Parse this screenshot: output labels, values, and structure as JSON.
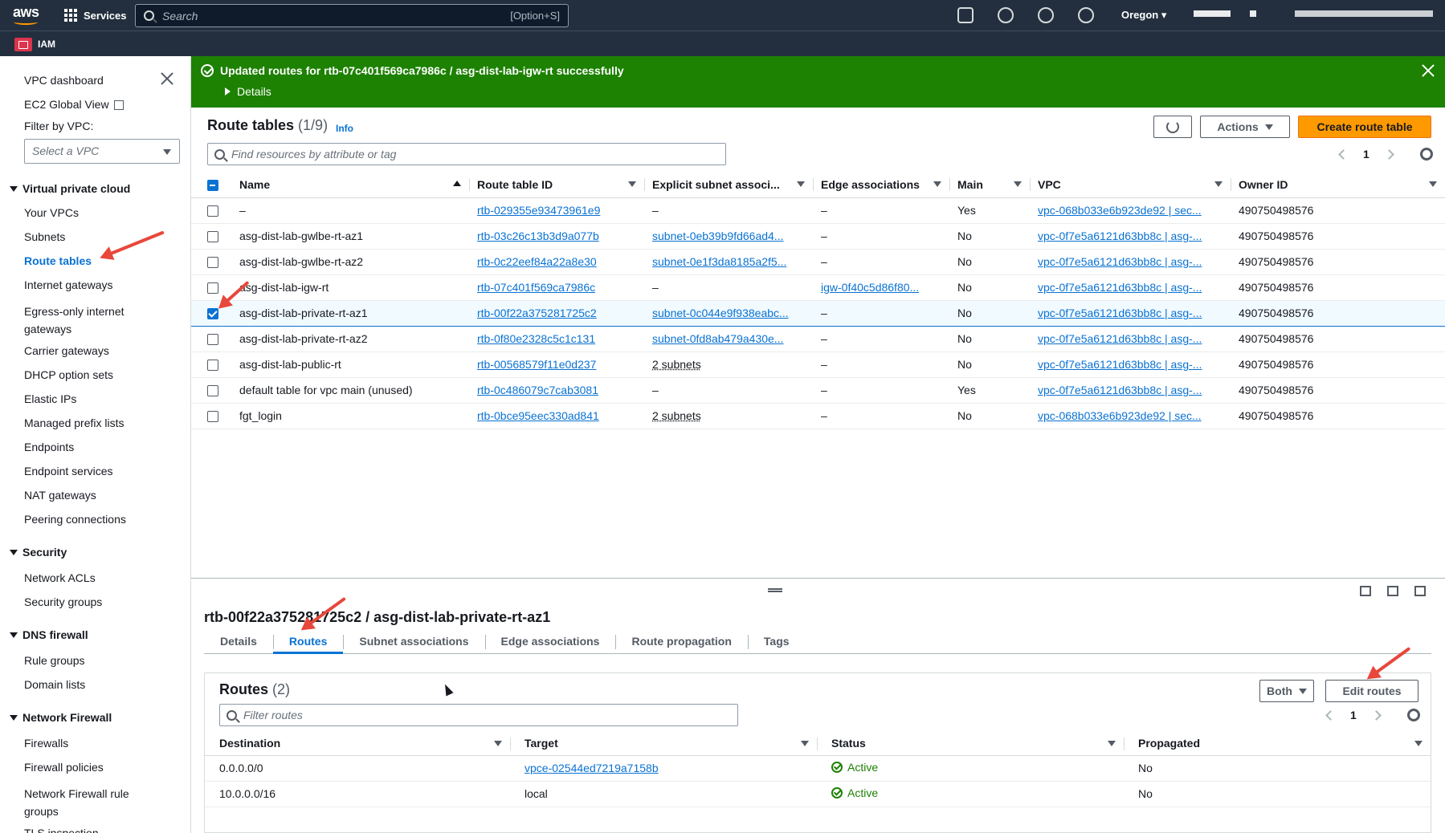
{
  "topnav": {
    "logo": "aws",
    "services_label": "Services",
    "search_placeholder": "Search",
    "search_shortcut": "[Option+S]",
    "region": "Oregon",
    "icons": [
      "cloudshell-icon",
      "bell-icon",
      "help-icon",
      "gear-icon"
    ]
  },
  "subnav": {
    "service_label": "IAM"
  },
  "sidebar": {
    "vpc_dashboard": "VPC dashboard",
    "ec2_global_view": "EC2 Global View",
    "filter_label": "Filter by VPC:",
    "filter_placeholder": "Select a VPC",
    "sections": [
      {
        "title": "Virtual private cloud",
        "items": [
          "Your VPCs",
          "Subnets",
          "Route tables",
          "Internet gateways",
          "Egress-only internet gateways",
          "Carrier gateways",
          "DHCP option sets",
          "Elastic IPs",
          "Managed prefix lists",
          "Endpoints",
          "Endpoint services",
          "NAT gateways",
          "Peering connections"
        ]
      },
      {
        "title": "Security",
        "items": [
          "Network ACLs",
          "Security groups"
        ]
      },
      {
        "title": "DNS firewall",
        "items": [
          "Rule groups",
          "Domain lists"
        ]
      },
      {
        "title": "Network Firewall",
        "items": [
          "Firewalls",
          "Firewall policies",
          "Network Firewall rule groups",
          "TLS inspection"
        ]
      }
    ],
    "active_item": "Route tables"
  },
  "flash": {
    "message": "Updated routes for rtb-07c401f569ca7986c / asg-dist-lab-igw-rt successfully",
    "details_label": "Details"
  },
  "route_tables": {
    "title": "Route tables",
    "count": "(1/9)",
    "info": "Info",
    "actions_label": "Actions",
    "create_label": "Create route table",
    "search_placeholder": "Find resources by attribute or tag",
    "page": "1",
    "columns": [
      "Name",
      "Route table ID",
      "Explicit subnet associ...",
      "Edge associations",
      "Main",
      "VPC",
      "Owner ID"
    ],
    "rows": [
      {
        "name": "–",
        "id": "rtb-029355e93473961e9",
        "subnet": "–",
        "edge": "–",
        "main": "Yes",
        "vpc": "vpc-068b033e6b923de92 | sec...",
        "owner": "490750498576",
        "selected": false
      },
      {
        "name": "asg-dist-lab-gwlbe-rt-az1",
        "id": "rtb-03c26c13b3d9a077b",
        "subnet": "subnet-0eb39b9fd66ad4...",
        "edge": "–",
        "main": "No",
        "vpc": "vpc-0f7e5a6121d63bb8c | asg-...",
        "owner": "490750498576",
        "selected": false
      },
      {
        "name": "asg-dist-lab-gwlbe-rt-az2",
        "id": "rtb-0c22eef84a22a8e30",
        "subnet": "subnet-0e1f3da8185a2f5...",
        "edge": "–",
        "main": "No",
        "vpc": "vpc-0f7e5a6121d63bb8c | asg-...",
        "owner": "490750498576",
        "selected": false
      },
      {
        "name": "asg-dist-lab-igw-rt",
        "id": "rtb-07c401f569ca7986c",
        "subnet": "–",
        "edge": "igw-0f40c5d86f80...",
        "main": "No",
        "vpc": "vpc-0f7e5a6121d63bb8c | asg-...",
        "owner": "490750498576",
        "selected": false
      },
      {
        "name": "asg-dist-lab-private-rt-az1",
        "id": "rtb-00f22a375281725c2",
        "subnet": "subnet-0c044e9f938eabc...",
        "edge": "–",
        "main": "No",
        "vpc": "vpc-0f7e5a6121d63bb8c | asg-...",
        "owner": "490750498576",
        "selected": true
      },
      {
        "name": "asg-dist-lab-private-rt-az2",
        "id": "rtb-0f80e2328c5c1c131",
        "subnet": "subnet-0fd8ab479a430e...",
        "edge": "–",
        "main": "No",
        "vpc": "vpc-0f7e5a6121d63bb8c | asg-...",
        "owner": "490750498576",
        "selected": false
      },
      {
        "name": "asg-dist-lab-public-rt",
        "id": "rtb-00568579f11e0d237",
        "subnet": "2 subnets",
        "edge": "–",
        "main": "No",
        "vpc": "vpc-0f7e5a6121d63bb8c | asg-...",
        "owner": "490750498576",
        "selected": false
      },
      {
        "name": "default table for vpc main (unused)",
        "id": "rtb-0c486079c7cab3081",
        "subnet": "–",
        "edge": "–",
        "main": "Yes",
        "vpc": "vpc-0f7e5a6121d63bb8c | asg-...",
        "owner": "490750498576",
        "selected": false
      },
      {
        "name": "fgt_login",
        "id": "rtb-0bce95eec330ad841",
        "subnet": "2 subnets",
        "edge": "–",
        "main": "No",
        "vpc": "vpc-068b033e6b923de92 | sec...",
        "owner": "490750498576",
        "selected": false
      }
    ]
  },
  "detail": {
    "title": "rtb-00f22a375281725c2 / asg-dist-lab-private-rt-az1",
    "tabs": [
      "Details",
      "Routes",
      "Subnet associations",
      "Edge associations",
      "Route propagation",
      "Tags"
    ],
    "active_tab": "Routes",
    "routes": {
      "title": "Routes",
      "count": "(2)",
      "filter_select": "Both",
      "edit_label": "Edit routes",
      "filter_placeholder": "Filter routes",
      "page": "1",
      "columns": [
        "Destination",
        "Target",
        "Status",
        "Propagated"
      ],
      "rows": [
        {
          "destination": "0.0.0.0/0",
          "target": "vpce-02544ed7219a7158b",
          "target_link": true,
          "status": "Active",
          "propagated": "No"
        },
        {
          "destination": "10.0.0.0/16",
          "target": "local",
          "target_link": false,
          "status": "Active",
          "propagated": "No"
        }
      ]
    }
  },
  "colors": {
    "nav_bg": "#232f3e",
    "success": "#1d8102",
    "link": "#0972d3",
    "primary": "#ff9900",
    "annotation": "#e8473b"
  }
}
